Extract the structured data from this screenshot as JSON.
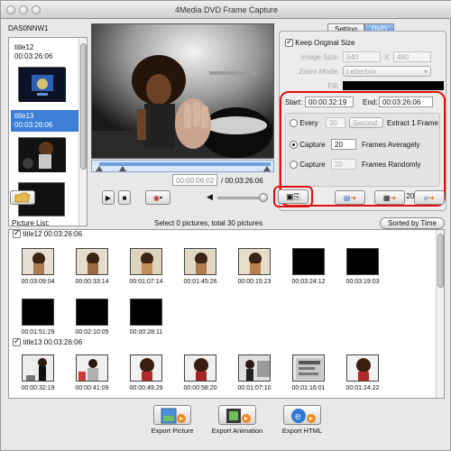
{
  "window": {
    "title": "4Media DVD Frame Capture"
  },
  "disc": {
    "name": "DAS0NNW1",
    "titles": [
      {
        "label": "title12",
        "duration": "00:03:26:06",
        "selected": false
      },
      {
        "label": "title13",
        "duration": "00:03:26:06",
        "selected": true
      }
    ]
  },
  "tabs": [
    {
      "label": "Setting",
      "active": false
    },
    {
      "label": "DVD",
      "active": true
    }
  ],
  "settings": {
    "keep_original_size": "Keep Original Size",
    "image_size_label": "Image Size:",
    "width": "640",
    "x": "X",
    "height": "480",
    "zoom_mode_label": "Zoom Mode:",
    "zoom_mode_value": "Letterbox",
    "fill_label": "Fill:",
    "fill_color": "#000000"
  },
  "capture": {
    "start_label": "Start:",
    "start_value": "00:00:32:19",
    "end_label": "End:",
    "end_value": "00:03:26:06",
    "every_label": "Every",
    "every_value": "30",
    "every_unit": "Second",
    "extract_label": "Extract 1 Frame",
    "capture_label": "Capture",
    "averagely_value": "20",
    "averagely_label": "Frames Averagely",
    "randomly_value": "20",
    "randomly_label": "Frames Randomly",
    "selected_mode": "averagely",
    "export_summary": "Export 20 frames"
  },
  "player": {
    "current_time": "00:00:06:02",
    "total_time": "/ 00:03:26:06",
    "volume": 0.9
  },
  "picture_list": {
    "label": "Picture List:",
    "status": "Select 0 pictures, total 30 pictures",
    "sort_button": "Sorted by Time",
    "groups": [
      {
        "header": "title12 00:03:26:06",
        "frames": [
          "00:03:09:04",
          "00:00:33:14",
          "00:01:07:14",
          "00:01:45:26",
          "00:00:15:23",
          "00:03:24:12",
          "00:03:19:03",
          "00:01:51:29",
          "00:02:10:05",
          "00:00:28:11"
        ]
      },
      {
        "header": "title13 00:03:26:06",
        "frames": [
          "00:00:32:19",
          "00:00:41:09",
          "00:00:49:29",
          "00:00:58:20",
          "00:01:07:10",
          "00:01:16:01",
          "00:01:24:22"
        ]
      }
    ]
  },
  "export": {
    "picture": "Export Picture",
    "animation": "Export Animation",
    "html": "Export HTML"
  },
  "colors": {
    "highlight": "#e01010",
    "selection": "#3d7fd6"
  }
}
